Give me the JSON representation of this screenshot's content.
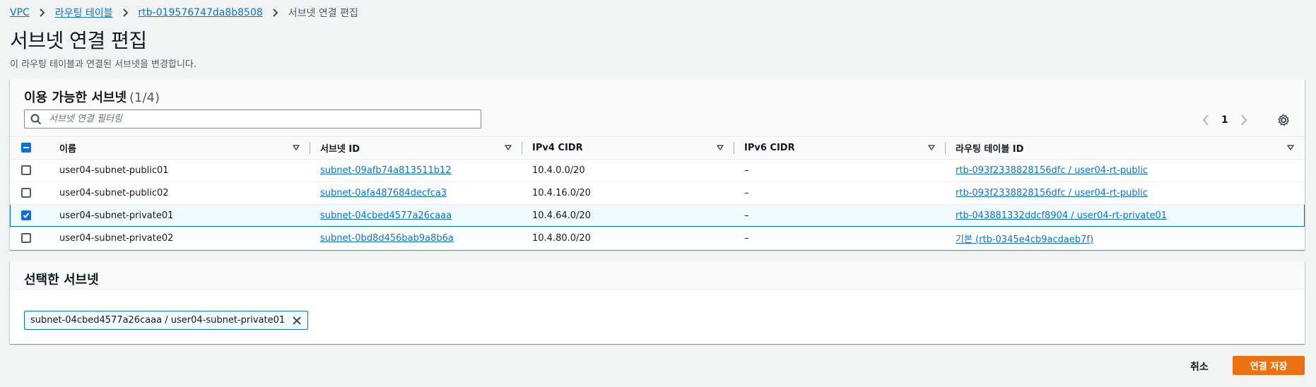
{
  "breadcrumb": {
    "items": [
      "VPC",
      "라우팅 테이블",
      "rtb-019576747da8b8508"
    ],
    "current": "서브넷 연결 편집"
  },
  "page": {
    "title": "서브넷 연결 편집",
    "description": "이 라우팅 테이블과 연결된 서브넷을 변경합니다."
  },
  "available": {
    "heading": "이용 가능한 서브넷",
    "count": "(1/4)",
    "filter_placeholder": "서브넷 연결 필터링",
    "page_number": "1",
    "columns": [
      "이름",
      "서브넷 ID",
      "IPv4 CIDR",
      "IPv6 CIDR",
      "라우팅 테이블 ID"
    ],
    "rows": [
      {
        "name": "user04-subnet-public01",
        "subnet_id": "subnet-09afb74a813511b12",
        "ipv4": "10.4.0.0/20",
        "ipv6": "–",
        "rtb": "rtb-093f2338828156dfc / user04-rt-public",
        "checked": false
      },
      {
        "name": "user04-subnet-public02",
        "subnet_id": "subnet-0afa487684decfca3",
        "ipv4": "10.4.16.0/20",
        "ipv6": "–",
        "rtb": "rtb-093f2338828156dfc / user04-rt-public",
        "checked": false
      },
      {
        "name": "user04-subnet-private01",
        "subnet_id": "subnet-04cbed4577a26caaa",
        "ipv4": "10.4.64.0/20",
        "ipv6": "–",
        "rtb": "rtb-043881332ddcf8904 / user04-rt-private01",
        "checked": true
      },
      {
        "name": "user04-subnet-private02",
        "subnet_id": "subnet-0bd8d456bab9a8b6a",
        "ipv4": "10.4.80.0/20",
        "ipv6": "–",
        "rtb": "기본 (rtb-0345e4cb9acdaeb7f)",
        "checked": false
      }
    ]
  },
  "selected": {
    "heading": "선택한 서브넷",
    "token_label": "subnet-04cbed4577a26caaa / user04-subnet-private01"
  },
  "footer": {
    "cancel_label": "취소",
    "save_label": "연결 저장"
  },
  "colors": {
    "link": "#0972d3",
    "primary_button": "#ec7211",
    "selected_row": "#f1faff"
  }
}
